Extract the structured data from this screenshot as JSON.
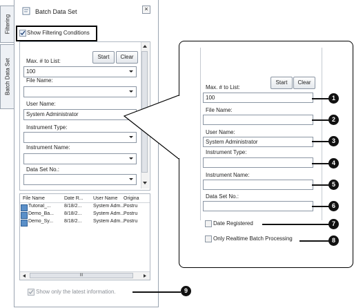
{
  "tabs": {
    "filtering": "Filtering",
    "batch_data_set": "Batch Data Set"
  },
  "panel": {
    "title": "Batch Data Set",
    "close_symbol": "×",
    "show_filtering_label": "Show Filtering Conditions",
    "max_label": "Max. # to List:",
    "max_value": "100",
    "start_label": "Start",
    "clear_label": "Clear",
    "file_name_label": "File Name:",
    "file_name_value": "",
    "user_name_label": "User Name:",
    "user_name_value": "System Administrator",
    "instrument_type_label": "Instrument Type:",
    "instrument_name_label": "Instrument Name:",
    "data_set_no_label": "Data Set No.:"
  },
  "table": {
    "columns": [
      "File Name",
      "Date R...",
      "User Name",
      "Origina"
    ],
    "rows": [
      [
        "Tutorial_...",
        "8/18/2...",
        "System Adm...",
        "Postru"
      ],
      [
        "Demo_Ba...",
        "8/18/2...",
        "System Adm...",
        "Postru"
      ],
      [
        "Demo_Sy...",
        "8/18/2...",
        "System Adm...",
        "Postru"
      ]
    ],
    "hscroll_glyph": "III"
  },
  "footer": {
    "show_latest_label": "Show only the latest information."
  },
  "callout": {
    "max_label": "Max. # to List:",
    "max_value": "100",
    "start_label": "Start",
    "clear_label": "Clear",
    "file_name_label": "File Name:",
    "user_name_label": "User Name:",
    "user_name_value": "System Administrator",
    "instrument_type_label": "Instrument Type:",
    "instrument_name_label": "Instrument Name:",
    "data_set_no_label": "Data Set No.:",
    "date_registered_label": "Date Registered",
    "realtime_label": "Only Realtime Batch Processing"
  },
  "badges": [
    "1",
    "2",
    "3",
    "4",
    "5",
    "6",
    "7",
    "8",
    "9"
  ]
}
